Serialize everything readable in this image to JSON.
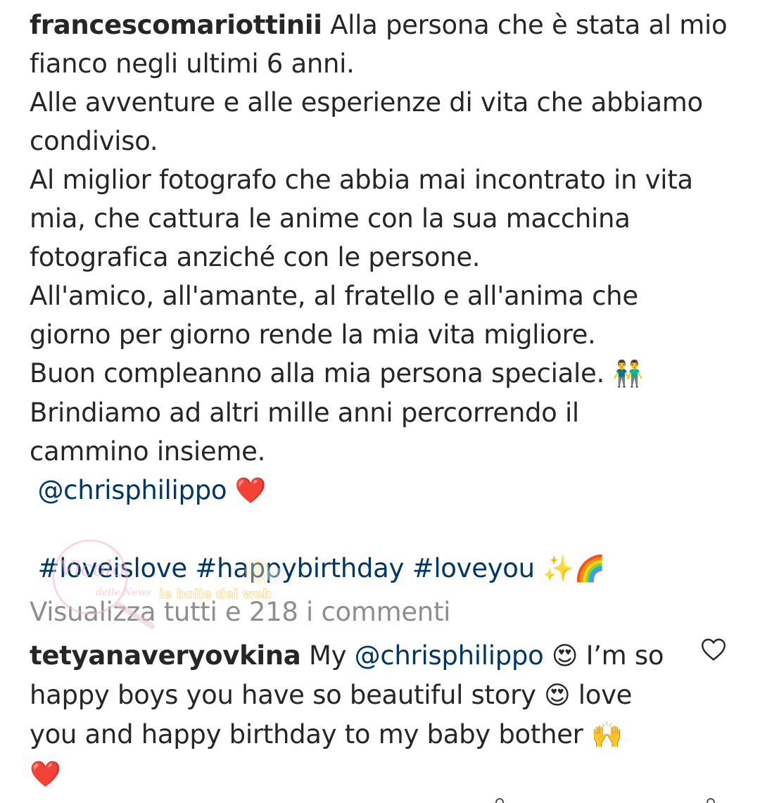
{
  "post": {
    "username": "francescomariottinii",
    "caption_lines": [
      "Alla persona che è stata al mio",
      "fianco negli ultimi 6 anni.",
      "Alle avventure e alle esperienze di vita che abbiamo",
      "condiviso.",
      "Al miglior fotografo che abbia mai incontrato in vita",
      "mia, che cattura le anime con la sua macchina",
      "fotografica anziché con le persone.",
      "All'amico, all'amante, al fratello e all'anima che",
      "giorno per giorno rende la mia vita migliore.",
      "Buon compleanno alla mia persona speciale.",
      "Brindiamo ad altri mille anni percorrendo il",
      "cammino insieme."
    ],
    "couple_emoji": "👬",
    "mention": "@chrisphilippo",
    "heart_emoji": "❤️",
    "hashtags": [
      "#loveislove",
      "#happybirthday",
      "#loveyou"
    ],
    "sparkles_emoji": "✨",
    "rainbow_emoji": "🌈"
  },
  "view_all_comments": "Visualizza tutti e 218 i commenti",
  "comment": {
    "username": "tetyanaveryovkina",
    "line1_prefix": "My",
    "mention": "@chrisphilippo",
    "heart_eyes_emoji": "😍",
    "line1_suffix": "I’m so",
    "line2_text": "happy boys you have so beautiful story",
    "line2_suffix": "love",
    "line3_text": "you and happy birthday to my baby bother",
    "raised_hands_emoji": "🙌",
    "heart_emoji": "❤️",
    "like_icon": "heart-outline-icon"
  },
  "watermark": {
    "text_main": "Vicolo",
    "text_sub": "delle News",
    "text_right": "le bolle del web"
  },
  "colors": {
    "text": "#262626",
    "link": "#00376b",
    "muted": "#8e8e8e"
  }
}
